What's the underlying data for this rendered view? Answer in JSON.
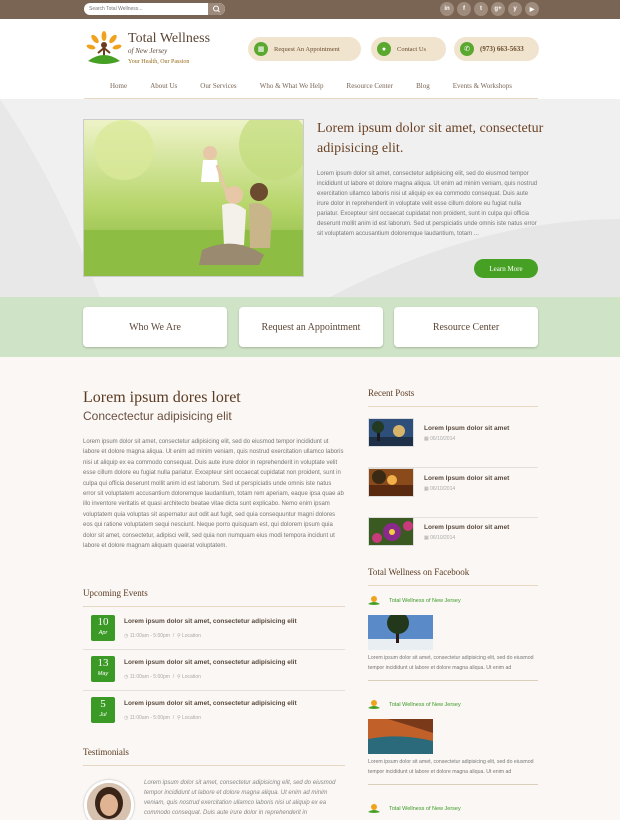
{
  "topbar": {
    "search_placeholder": "Search Total Wellness...",
    "social": [
      {
        "icon": "linkedin-icon",
        "glyph": "in"
      },
      {
        "icon": "facebook-icon",
        "glyph": "f"
      },
      {
        "icon": "twitter-icon",
        "glyph": "t"
      },
      {
        "icon": "google-plus-icon",
        "glyph": "g+"
      },
      {
        "icon": "yelp-icon",
        "glyph": "y"
      },
      {
        "icon": "youtube-icon",
        "glyph": "▶"
      }
    ]
  },
  "header": {
    "logo_title": "Total Wellness",
    "logo_of": "of New Jersey",
    "logo_tagline": "Your Health, Our Passion",
    "appointment_label": "Request An Appointment",
    "contact_label": "Contact Us",
    "phone": "(973) 663-5633"
  },
  "nav": [
    "Home",
    "About Us",
    "Our Services",
    "Who & What We Help",
    "Resource Center",
    "Blog",
    "Events & Workshops"
  ],
  "hero": {
    "title": "Lorem ipsum dolor sit amet, consectetur adipisicing elit.",
    "text": "Lorem ipsum dolor sit amet, consectetur adipisicing elit, sed do eiusmod tempor incididunt ut labore et dolore magna aliqua. Ut enim ad minim veniam, quis nostrud exercitation ullamco laboris nisi ut aliquip ex ea commodo consequat. Duis aute irure dolor in reprehenderit in voluptate velit esse cillum dolore eu fugiat nulla pariatur. Excepteur sint occaecat cupidatat non proident, sunt in culpa qui officia deserunt mollit anim id est laborum. Sed ut perspiciatis unde omnis iste natus error sit voluptatem accusantium doloremque laudantium, totam ...",
    "button": "Learn More"
  },
  "band": [
    "Who We Are",
    "Request an Appointment",
    "Resource Center"
  ],
  "main": {
    "heading": "Lorem ipsum dores loret",
    "subheading": "Concectectur adipisicing elit",
    "text": "Lorem ipsum dolor sit amet, consectetur adipisicing elit, sed do eiusmod tempor incididunt ut labore et dolore magna aliqua. Ut enim ad minim veniam, quis nostrud exercitation ullamco laboris nisi ut aliquip ex ea commodo consequat. Duis aute irure dolor in reprehenderit in voluptate velit esse cillum dolore eu fugiat nulla pariatur. Excepteur sint occaecat cupidatat non proident, sunt in culpa qui officia deserunt mollit anim id est laborum. Sed ut perspiciatis unde omnis iste natus error sit voluptatem accusantium doloremque laudantium, totam rem aperiam, eaque ipsa quae ab illo inventore veritatis et quasi architecto beatae vitae dicta sunt explicabo. Nemo enim ipsam voluptatem quia voluptas sit aspernatur aut odit aut fugit, sed quia consequuntur magni dolores eos qui ratione voluptatem sequi nesciunt. Neque porro quisquam est, qui dolorem ipsum quia dolor sit amet, consectetur, adipisci velit, sed quia non numquam eius modi tempora incidunt ut labore et dolore magnam aliquam quaerat voluptatem."
  },
  "events": {
    "title": "Upcoming Events",
    "items": [
      {
        "day": "10",
        "month": "Apr",
        "title": "Lorem ipsum dolor sit amet, consectetur adipisicing elit",
        "time": "11:00am - 5:00pm",
        "location": "Location"
      },
      {
        "day": "13",
        "month": "May",
        "title": "Lorem ipsum dolor sit amet, consectetur adipisicing elit",
        "time": "11:00am - 5:00pm",
        "location": "Location"
      },
      {
        "day": "5",
        "month": "Jul",
        "title": "Lorem ipsum dolor sit amet, consectetur adipisicing elit",
        "time": "11:00am - 5:00pm",
        "location": "Location"
      }
    ]
  },
  "testimonials": {
    "title": "Testimonials",
    "text": "Lorem ipsum dolor sit amet, consectetur adipisicing elit, sed do eiusmod tempor incididunt ut labore et dolore magna aliqua. Ut enim ad minim veniam, quis nostrud exercitation ullamco laboris nisi ut aliquip ex ea commodo consequat. Duis aute irure dolor in reprehenderit in"
  },
  "recent_posts": {
    "title": "Recent Posts",
    "items": [
      {
        "title": "Lorem Ipsum dolor sit amet",
        "date": "06/10/2014"
      },
      {
        "title": "Lorem Ipsum dolor sit amet",
        "date": "06/10/2014"
      },
      {
        "title": "Lorem Ipsum dolor sit amet",
        "date": "06/10/2014"
      }
    ]
  },
  "facebook": {
    "title": "Total Wellness on Facebook",
    "items": [
      {
        "name": "Total Wellness of New Jersey",
        "text": "Lorem ipsum dolor sit amet, consectetur adipisicing elit, sed do eiusmod tempor incididunt ut labore et dolore magna aliqua. Ut enim ad"
      },
      {
        "name": "Total Wellness of New Jersey",
        "text": "Lorem ipsum dolor sit amet, consectetur adipisicing elit, sed do eiusmod tempor incididunt ut labore et dolore magna aliqua. Ut enim ad"
      },
      {
        "name": "Total Wellness of New Jersey",
        "text": ""
      }
    ]
  },
  "colors": {
    "brand_brown": "#7a6555",
    "accent_green": "#46a024",
    "band_green": "#cfe3c6"
  }
}
